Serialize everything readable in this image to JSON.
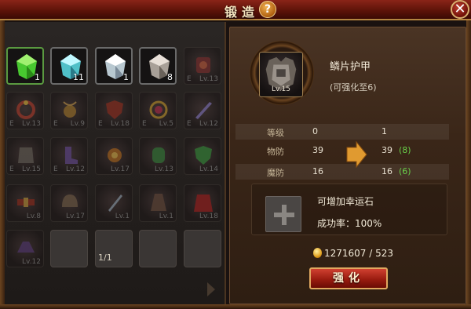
{
  "window": {
    "title": "锻造",
    "help_label": "?",
    "close_label": "✕"
  },
  "inventory": {
    "materials": [
      {
        "icon": "green-crystal-icon",
        "quantity": "1",
        "color": "#5adc3a"
      },
      {
        "icon": "cyan-crystal-icon",
        "quantity": "11",
        "color": "#6ae0e8"
      },
      {
        "icon": "white-crystal-icon",
        "quantity": "1",
        "color": "#d8e8f0"
      },
      {
        "icon": "gray-crystal-icon",
        "quantity": "8",
        "color": "#c8c0b8"
      }
    ],
    "equipment": [
      {
        "icon": "rune-stone-icon",
        "mark": "E",
        "level": "Lv.13"
      },
      {
        "icon": "ring-icon",
        "mark": "E",
        "level": "Lv.13"
      },
      {
        "icon": "amulet-icon",
        "mark": "E",
        "level": "Lv.9"
      },
      {
        "icon": "shield-icon",
        "mark": "E",
        "level": "Lv.18"
      },
      {
        "icon": "gem-ring-icon",
        "mark": "E",
        "level": "Lv.5"
      },
      {
        "icon": "sword-icon",
        "mark": "E",
        "level": "Lv.12"
      },
      {
        "icon": "armor-icon",
        "mark": "E",
        "level": "Lv.15"
      },
      {
        "icon": "boots-icon",
        "mark": "E",
        "level": "Lv.12"
      },
      {
        "icon": "necklace-icon",
        "mark": "",
        "level": "Lv.17"
      },
      {
        "icon": "green-bracer-icon",
        "mark": "",
        "level": "Lv.13"
      },
      {
        "icon": "green-shield-icon",
        "mark": "",
        "level": "Lv.14"
      },
      {
        "icon": "belt-icon",
        "mark": "",
        "level": "Lv.8"
      },
      {
        "icon": "helmet-icon",
        "mark": "",
        "level": "Lv.17"
      },
      {
        "icon": "blade-icon",
        "mark": "",
        "level": "Lv.1"
      },
      {
        "icon": "robe-icon",
        "mark": "",
        "level": "Lv.1"
      },
      {
        "icon": "cape-icon",
        "mark": "",
        "level": "Lv.18"
      },
      {
        "icon": "hat-icon",
        "mark": "",
        "level": "Lv.12"
      }
    ],
    "page": "1/1"
  },
  "item": {
    "name": "鳞片护甲",
    "level": "Lv.15",
    "note": "(可强化至6)",
    "icon": "scale-armor-icon"
  },
  "stats": [
    {
      "label": "等级",
      "current": "0",
      "next": "1",
      "bonus": ""
    },
    {
      "label": "物防",
      "current": "39",
      "next": "39",
      "bonus": "(8)"
    },
    {
      "label": "魔防",
      "current": "16",
      "next": "16",
      "bonus": "(6)"
    }
  ],
  "lucky_stone": {
    "label": "可增加幸运石",
    "rate": "成功率：100%"
  },
  "cost": {
    "text": "1271607 /   523"
  },
  "actions": {
    "enhance_label": "强化"
  },
  "colors": {
    "accent": "#b48440",
    "button": "#9a1c10",
    "bonus": "#6ad04a"
  }
}
